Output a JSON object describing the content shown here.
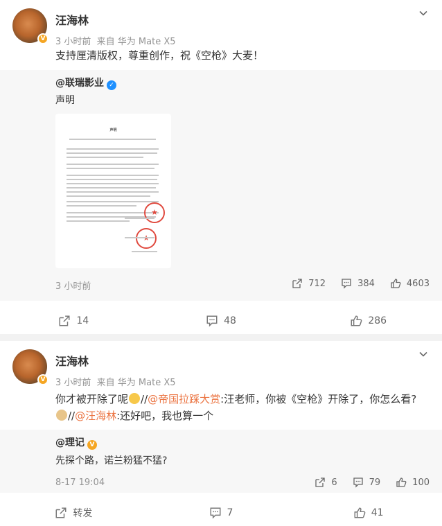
{
  "posts": [
    {
      "author": "汪海林",
      "time": "3 小时前",
      "source": "来自 华为 Mate X5",
      "text": "支持厘清版权，尊重创作，祝《空枪》大麦！",
      "repost": {
        "author": "@联瑞影业",
        "text": "声明",
        "image_title": "声明",
        "time": "3 小时前",
        "reposts": "712",
        "comments": "384",
        "likes": "4603"
      },
      "reposts": "14",
      "comments": "48",
      "likes": "286"
    },
    {
      "author": "汪海林",
      "time": "3 小时前",
      "source": "来自 华为 Mate X5",
      "text_part1": "你才被开除了呢",
      "text_sep1": "//",
      "mention1": "@帝国拉踩大赏",
      "text_part2": ":汪老师，你被《空枪》开除了，你怎么看?",
      "text_sep2": "//",
      "mention2": "@汪海林",
      "text_part3": ":还好吧，我也算一个",
      "repost": {
        "author": "@理记",
        "text": "先探个路，诺兰粉猛不猛?",
        "time": "8-17 19:04",
        "reposts": "6",
        "comments": "79",
        "likes": "100"
      },
      "repost_label": "转发",
      "comments": "7",
      "likes": "41"
    }
  ],
  "icons": {
    "more": "chevron-down-icon",
    "repost": "share-icon",
    "comment": "comment-icon",
    "like": "thumbs-up-icon"
  },
  "colors": {
    "link": "#eb7340",
    "verified_blue": "#1e90ff",
    "verified_orange": "#f5a623"
  }
}
